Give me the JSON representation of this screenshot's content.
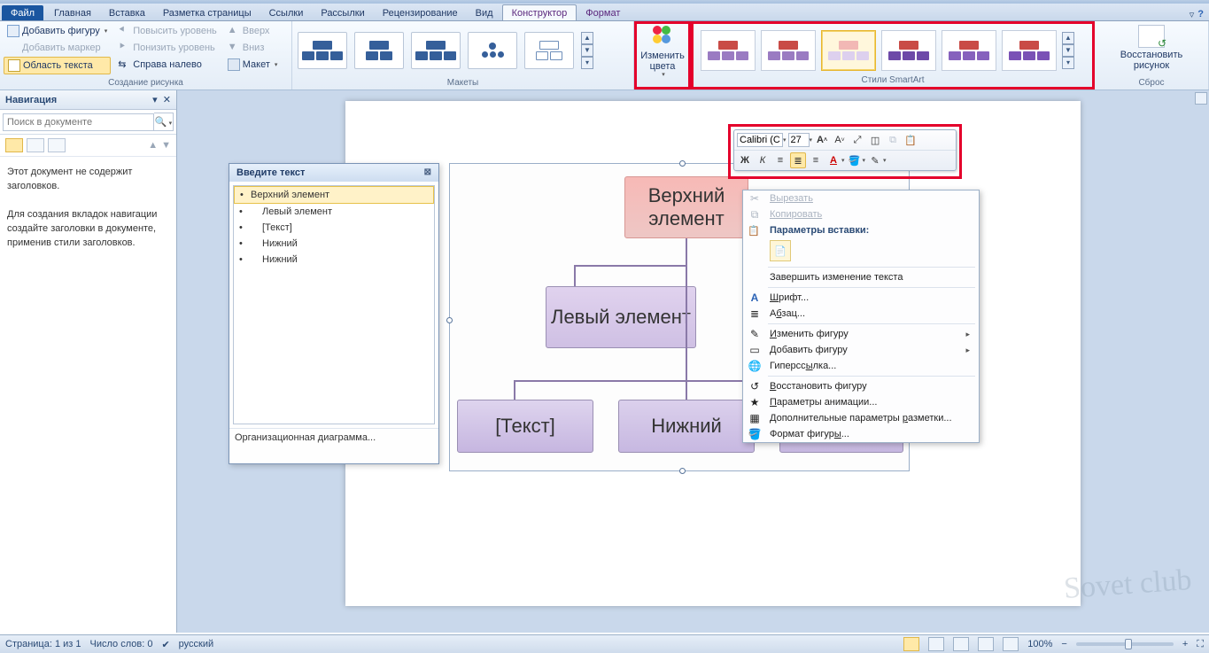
{
  "tabs": {
    "file": "Файл",
    "items": [
      "Главная",
      "Вставка",
      "Разметка страницы",
      "Ссылки",
      "Рассылки",
      "Рецензирование",
      "Вид",
      "Конструктор",
      "Формат"
    ],
    "active": "Конструктор"
  },
  "ribbon": {
    "g1": {
      "add_shape": "Добавить фигуру",
      "add_marker": "Добавить маркер",
      "text_area": "Область текста",
      "prom": "Повысить уровень",
      "dem": "Понизить уровень",
      "rtl": "Справа налево",
      "up": "Вверх",
      "down": "Вниз",
      "layout": "Макет",
      "label": "Создание рисунка"
    },
    "g2_label": "Макеты",
    "colors_btn": "Изменить\nцвета",
    "g3_label": "Стили SmartArt",
    "reset": {
      "title": "Восстановить рисунок",
      "label": "Сброс"
    }
  },
  "nav": {
    "title": "Навигация",
    "search_ph": "Поиск в документе",
    "msg1": "Этот документ не содержит заголовков.",
    "msg2": "Для создания вкладок навигации создайте заголовки в документе, применив стили заголовков."
  },
  "textpane": {
    "title": "Введите текст",
    "items": [
      "Верхний элемент",
      "Левый элемент",
      "[Текст]",
      "Нижний",
      "Нижний"
    ],
    "footer": "Организационная диаграмма..."
  },
  "smartart": {
    "top": "Верхний элемент",
    "left": "Левый элемент",
    "text": "[Текст]",
    "lower": "Нижний"
  },
  "minitb": {
    "font": "Calibri (С",
    "size": "27"
  },
  "ctx": {
    "cut": "Вырезать",
    "copy": "Копировать",
    "paste_hdr": "Параметры вставки:",
    "endedit": "Завершить изменение текста",
    "font": "Шрифт...",
    "para": "Абзац...",
    "chshape": "Изменить фигуру",
    "addshape": "Добавить фигуру",
    "link": "Гиперссылка...",
    "restore": "Восстановить фигуру",
    "anim": "Параметры анимации...",
    "more": "Дополнительные параметры разметки...",
    "fmt": "Формат фигуры..."
  },
  "status": {
    "page": "Страница: 1 из 1",
    "words": "Число слов: 0",
    "lang": "русский",
    "zoom": "100%"
  },
  "watermark": "Sovet club"
}
